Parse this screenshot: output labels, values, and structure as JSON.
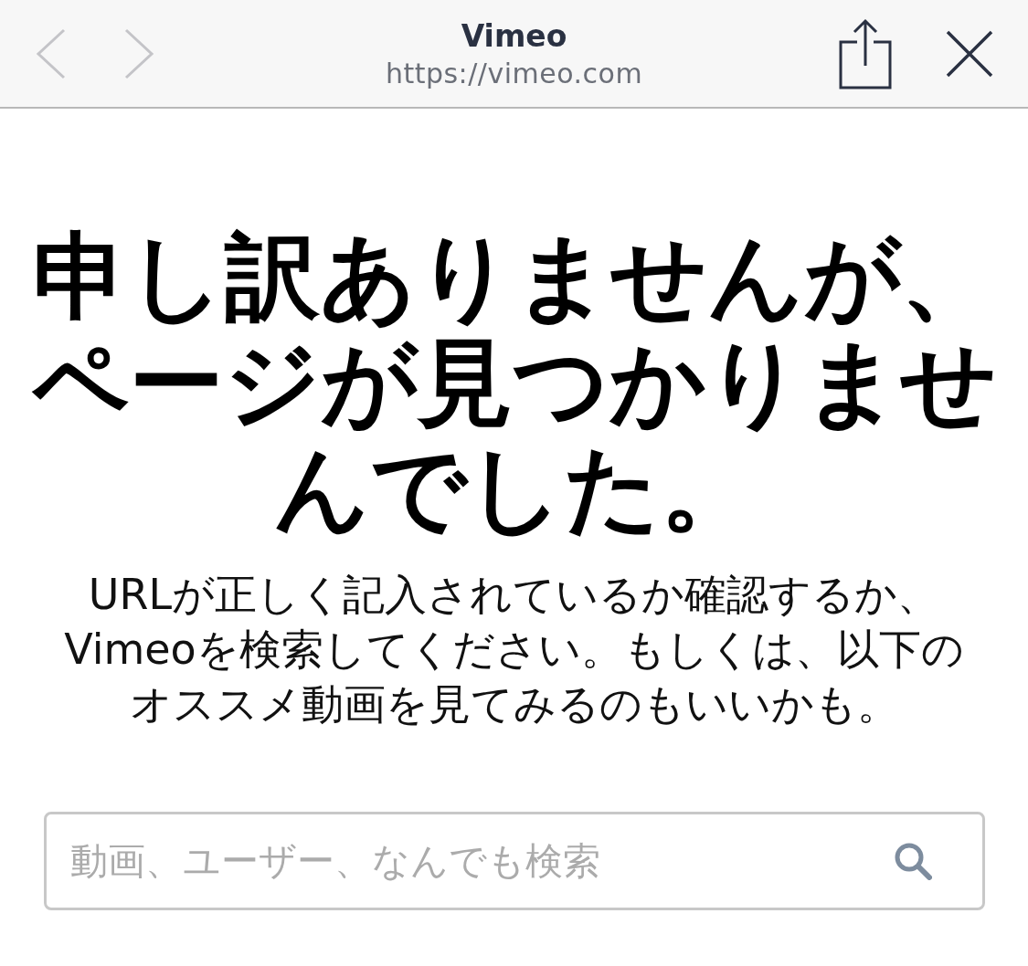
{
  "browser_bar": {
    "title": "Vimeo",
    "url": "https://vimeo.com",
    "back_disabled": true,
    "forward_disabled": true
  },
  "error": {
    "headline": "申し訳ありませんが、ページが見つかりませんでした。",
    "message": "URLが正しく記入されているか確認するか、Vimeoを検索してください。もしくは、以下のオススメ動画を見てみるのもいいかも。"
  },
  "search": {
    "placeholder": "動画、ユーザー、なんでも検索"
  }
}
